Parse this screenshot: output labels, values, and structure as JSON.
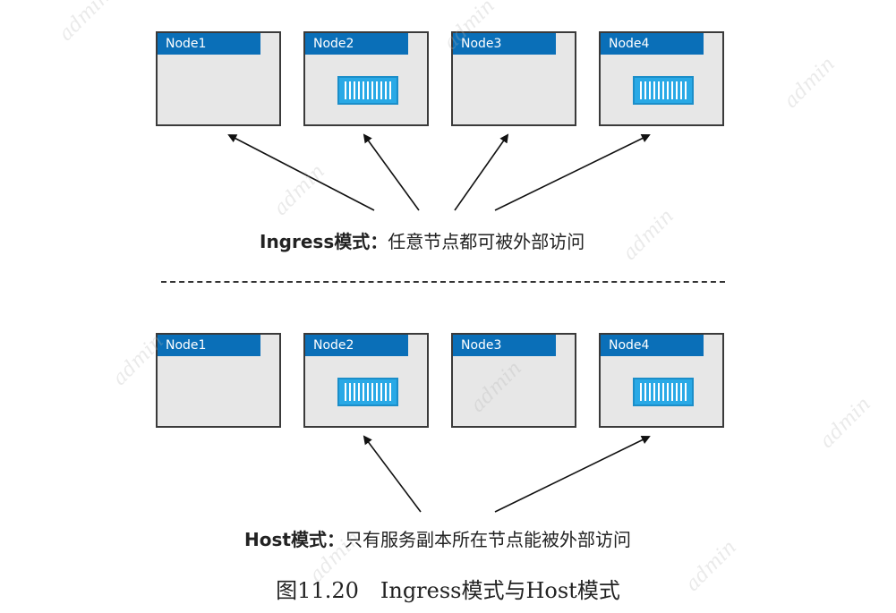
{
  "ingress": {
    "label_bold": "Ingress模式：",
    "label_rest": "任意节点都可被外部访问",
    "nodes": [
      {
        "name": "Node1",
        "has_container": false
      },
      {
        "name": "Node2",
        "has_container": true
      },
      {
        "name": "Node3",
        "has_container": false
      },
      {
        "name": "Node4",
        "has_container": true
      }
    ]
  },
  "host": {
    "label_bold": "Host模式：",
    "label_rest": "只有服务副本所在节点能被外部访问",
    "nodes": [
      {
        "name": "Node1",
        "has_container": false
      },
      {
        "name": "Node2",
        "has_container": true
      },
      {
        "name": "Node3",
        "has_container": false
      },
      {
        "name": "Node4",
        "has_container": true
      }
    ]
  },
  "caption": "图11.20　Ingress模式与Host模式",
  "watermark": "admin",
  "colors": {
    "node_fill": "#e7e7e7",
    "node_border": "#3a3a3a",
    "tab_fill": "#0a6fb8",
    "container_fill": "#29a9e6"
  }
}
